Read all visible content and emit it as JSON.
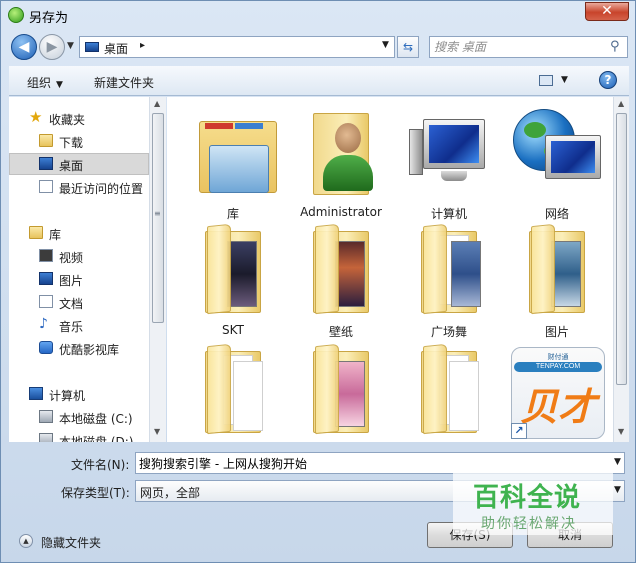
{
  "window": {
    "title": "另存为",
    "close_glyph": "✕"
  },
  "address_bar": {
    "crumbs": [
      "桌面"
    ],
    "separator": "▸"
  },
  "search": {
    "placeholder": "搜索 桌面"
  },
  "toolbar": {
    "organize_label": "组织",
    "new_folder_label": "新建文件夹",
    "help_label": "?"
  },
  "nav_pane": {
    "items": [
      {
        "label": "收藏夹",
        "icon": "star-icon"
      },
      {
        "label": "下载",
        "icon": "download-folder-icon"
      },
      {
        "label": "桌面",
        "icon": "desktop-icon",
        "selected": true
      },
      {
        "label": "最近访问的位置",
        "icon": "recent-places-icon"
      },
      {
        "label": "库",
        "icon": "library-icon"
      },
      {
        "label": "视频",
        "icon": "video-icon"
      },
      {
        "label": "图片",
        "icon": "picture-icon"
      },
      {
        "label": "文档",
        "icon": "document-icon"
      },
      {
        "label": "音乐",
        "icon": "music-icon"
      },
      {
        "label": "优酷影视库",
        "icon": "youku-icon"
      },
      {
        "label": "计算机",
        "icon": "computer-icon"
      },
      {
        "label": "本地磁盘 (C:)",
        "icon": "drive-icon"
      },
      {
        "label": "本地磁盘 (D:)",
        "icon": "drive-icon"
      }
    ]
  },
  "content": {
    "items": [
      {
        "label": "库",
        "icon": "libraries-icon"
      },
      {
        "label": "Administrator",
        "icon": "user-folder-icon"
      },
      {
        "label": "计算机",
        "icon": "computer-icon"
      },
      {
        "label": "网络",
        "icon": "network-icon"
      },
      {
        "label": "SKT",
        "icon": "folder-icon"
      },
      {
        "label": "壁纸",
        "icon": "folder-icon"
      },
      {
        "label": "广场舞",
        "icon": "folder-icon"
      },
      {
        "label": "图片",
        "icon": "folder-icon"
      },
      {
        "label": "",
        "icon": "folder-icon"
      },
      {
        "label": "",
        "icon": "folder-icon"
      },
      {
        "label": "",
        "icon": "folder-icon"
      },
      {
        "label": "",
        "icon": "tenpay-shortcut-icon",
        "logo_band": "TENPAY.COM",
        "logo_text": "财付通",
        "logo_glyph": "贝才"
      }
    ]
  },
  "form": {
    "filename_label": "文件名(N):",
    "filename_value": "搜狗搜索引擎 - 上网从搜狗开始",
    "filetype_label": "保存类型(T):",
    "filetype_value": "网页，全部"
  },
  "footer": {
    "hide_folders_label": "隐藏文件夹",
    "save_label": "保存(S)",
    "cancel_label": "取消"
  },
  "watermark": {
    "title": "百科全说",
    "subtitle": "助你轻松解决"
  }
}
